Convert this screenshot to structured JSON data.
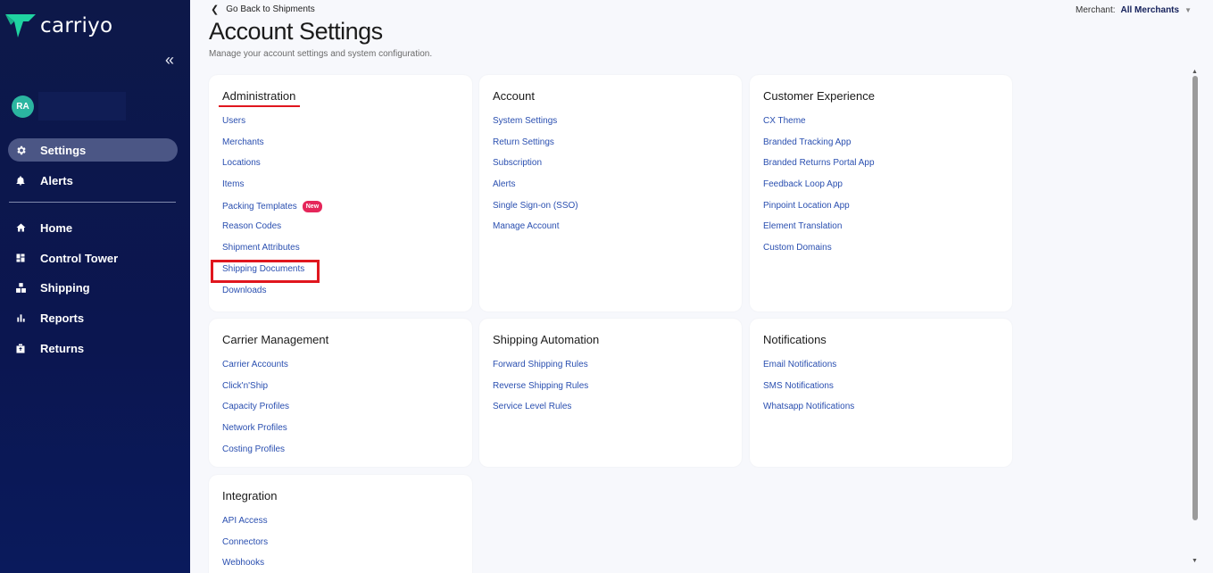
{
  "brand": {
    "name": "carriyo",
    "color": "#1fd3a1"
  },
  "sidebar": {
    "collapse_glyph": "«",
    "user": {
      "initials": "RA"
    },
    "items": [
      {
        "label": "Settings",
        "icon": "gear-icon",
        "active": true
      },
      {
        "label": "Alerts",
        "icon": "bell-icon",
        "active": false
      },
      {
        "label": "Home",
        "icon": "home-icon",
        "active": false
      },
      {
        "label": "Control Tower",
        "icon": "dashboard-icon",
        "active": false
      },
      {
        "label": "Shipping",
        "icon": "boxes-icon",
        "active": false
      },
      {
        "label": "Reports",
        "icon": "bar-chart-icon",
        "active": false
      },
      {
        "label": "Returns",
        "icon": "return-box-icon",
        "active": false
      }
    ]
  },
  "header": {
    "back_label": "Go Back to Shipments",
    "title": "Account Settings",
    "subtitle": "Manage your account settings and system configuration.",
    "merchant_label": "Merchant:",
    "merchant_value": "All Merchants"
  },
  "cards": {
    "administration": {
      "title": "Administration",
      "links": [
        "Users",
        "Merchants",
        "Locations",
        "Items",
        "Packing Templates",
        "Reason Codes",
        "Shipment Attributes",
        "Shipping Documents",
        "Downloads"
      ],
      "new_badge": "New"
    },
    "account": {
      "title": "Account",
      "links": [
        "System Settings",
        "Return Settings",
        "Subscription",
        "Alerts",
        "Single Sign-on (SSO)",
        "Manage Account"
      ]
    },
    "customer_experience": {
      "title": "Customer Experience",
      "links": [
        "CX Theme",
        "Branded Tracking App",
        "Branded Returns Portal App",
        "Feedback Loop App",
        "Pinpoint Location App",
        "Element Translation",
        "Custom Domains"
      ]
    },
    "carrier_management": {
      "title": "Carrier Management",
      "links": [
        "Carrier Accounts",
        "Click'n'Ship",
        "Capacity Profiles",
        "Network Profiles",
        "Costing Profiles"
      ]
    },
    "shipping_automation": {
      "title": "Shipping Automation",
      "links": [
        "Forward Shipping Rules",
        "Reverse Shipping Rules",
        "Service Level Rules"
      ]
    },
    "notifications": {
      "title": "Notifications",
      "links": [
        "Email Notifications",
        "SMS Notifications",
        "Whatsapp Notifications"
      ]
    },
    "integration": {
      "title": "Integration",
      "links": [
        "API Access",
        "Connectors",
        "Webhooks"
      ]
    }
  },
  "colors": {
    "sidebar_bg": "#0b1650",
    "link": "#2a4fb0",
    "highlight": "#e0161e",
    "badge": "#e5265a"
  }
}
